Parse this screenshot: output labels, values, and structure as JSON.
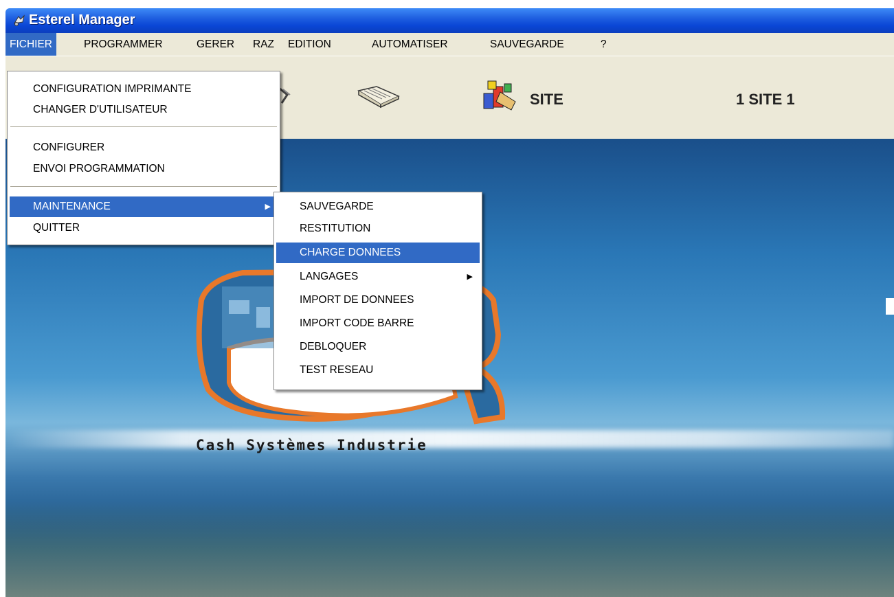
{
  "window": {
    "title": "Esterel Manager"
  },
  "menubar": [
    "FICHIER",
    "PROGRAMMER",
    "GERER",
    "RAZ",
    "EDITION",
    "AUTOMATISER",
    "SAUVEGARDE",
    "?"
  ],
  "toolbar": {
    "site_label": "SITE",
    "site_value": "1 SITE 1"
  },
  "fichier_menu": {
    "items": [
      "CONFIGURATION IMPRIMANTE",
      "CHANGER D'UTILISATEUR",
      "CONFIGURER",
      "ENVOI PROGRAMMATION",
      "MAINTENANCE",
      "QUITTER"
    ],
    "selected": "MAINTENANCE"
  },
  "maintenance_menu": {
    "items": [
      "SAUVEGARDE",
      "RESTITUTION",
      "CHARGE DONNEES",
      "LANGAGES",
      "IMPORT DE DONNEES",
      "IMPORT CODE BARRE",
      "DEBLOQUER",
      "TEST RESEAU"
    ],
    "selected": "CHARGE DONNEES"
  },
  "logo": {
    "caption": "Cash Systèmes Industrie"
  },
  "colors": {
    "titlebar": "#0a46d6",
    "highlight": "#316ac5",
    "menubar": "#ece9d8",
    "logo_orange": "#e8782a"
  }
}
